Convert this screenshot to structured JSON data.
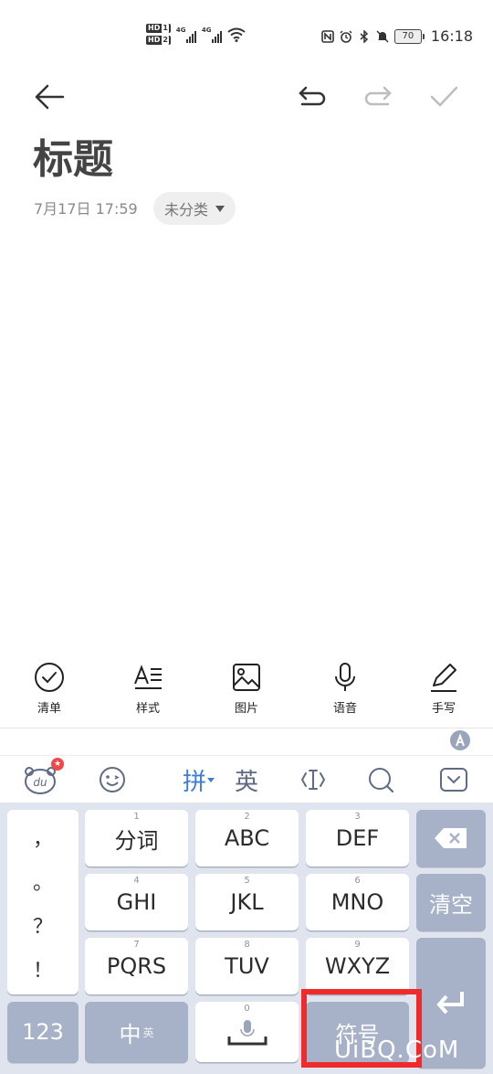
{
  "status_bar": {
    "hd_labels": [
      "HD",
      "HD"
    ],
    "hd_sims": [
      "1",
      "2"
    ],
    "network": [
      "4G",
      "4G"
    ],
    "battery": "70",
    "time": "16:18"
  },
  "note": {
    "title": "标题",
    "date": "7月17日 17:59",
    "category": "未分类"
  },
  "format_bar": {
    "items": [
      {
        "label": "清单",
        "icon": "checklist-icon"
      },
      {
        "label": "样式",
        "icon": "text-style-icon"
      },
      {
        "label": "图片",
        "icon": "image-icon"
      },
      {
        "label": "语音",
        "icon": "microphone-icon"
      },
      {
        "label": "手写",
        "icon": "pen-icon"
      }
    ]
  },
  "ime_bar": {
    "pinyin": "拼",
    "english": "英"
  },
  "keyboard": {
    "symbols": [
      "，",
      "。",
      "？",
      "！"
    ],
    "keys": [
      {
        "num": "1",
        "label": "分词"
      },
      {
        "num": "2",
        "label": "ABC"
      },
      {
        "num": "3",
        "label": "DEF"
      },
      {
        "num": "4",
        "label": "GHI"
      },
      {
        "num": "5",
        "label": "JKL"
      },
      {
        "num": "6",
        "label": "MNO"
      },
      {
        "num": "7",
        "label": "PQRS"
      },
      {
        "num": "8",
        "label": "TUV"
      },
      {
        "num": "9",
        "label": "WXYZ"
      }
    ],
    "clear": "清空",
    "numbers": "123",
    "zh": "中",
    "zh_sub": "英",
    "space_num": "0",
    "symbol": "符号"
  },
  "watermark": "UiBQ.CoM",
  "colors": {
    "accent": "#3b7ddd",
    "keyboard_bg": "#dfe4ee",
    "function_key": "#a7b2c8",
    "highlight": "#ee2a2a"
  }
}
